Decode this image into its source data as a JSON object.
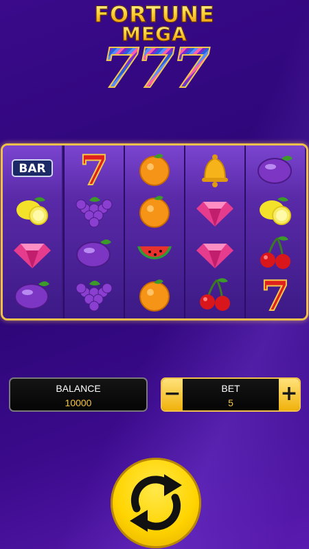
{
  "logo": {
    "line1": "FORTUNE",
    "line2": "MEGA",
    "line3": "777"
  },
  "reels": [
    [
      "bar",
      "lemon",
      "gem",
      "plum"
    ],
    [
      "seven",
      "grapes",
      "plum",
      "grapes"
    ],
    [
      "orange",
      "orange",
      "watermelon",
      "orange"
    ],
    [
      "bell",
      "gem",
      "gem",
      "cherries"
    ],
    [
      "plum",
      "lemon",
      "cherries",
      "seven"
    ]
  ],
  "symbol_text": {
    "bar": "BAR",
    "seven": "7"
  },
  "balance": {
    "label": "BALANCE",
    "value": "10000"
  },
  "bet": {
    "label": "BET",
    "value": "5",
    "minus": "−",
    "plus": "+"
  },
  "spin": {
    "icon": "refresh-icon"
  },
  "colors": {
    "background": "#2c0676",
    "gold": "#f2c14b",
    "value_text": "#f5c644",
    "spin_yellow": "#ffd400"
  }
}
